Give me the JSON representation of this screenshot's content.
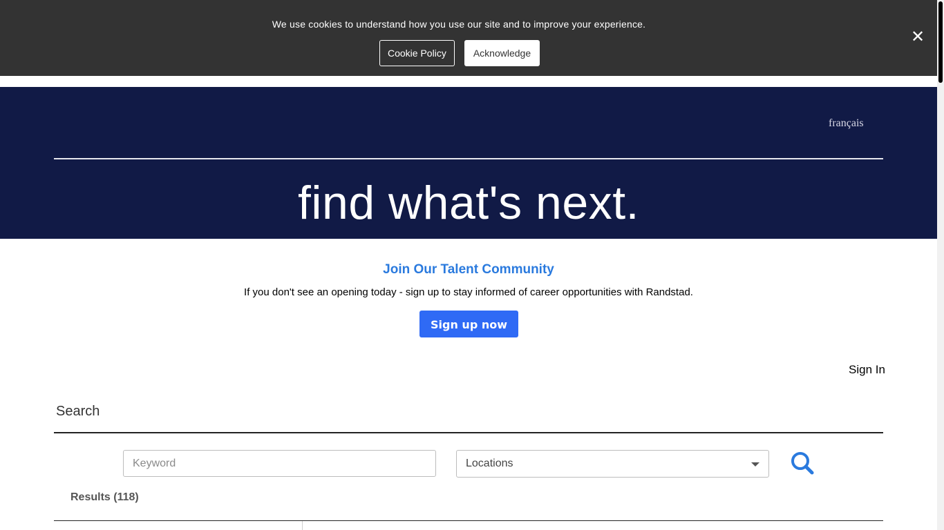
{
  "cookie_banner": {
    "message": "We use cookies to understand how you use our site and to improve your experience.",
    "policy_label": "Cookie Policy",
    "acknowledge_label": "Acknowledge",
    "close_icon": "close-icon",
    "close_glyph": "✕"
  },
  "header": {
    "language_link": "français",
    "hero_title": "find what's next."
  },
  "talent_community": {
    "title": "Join Our Talent Community",
    "text": "If you don't see an opening today - sign up to stay informed of career opportunities with Randstad.",
    "signup_label": "Sign up now"
  },
  "account": {
    "sign_in_label": "Sign In"
  },
  "search": {
    "heading": "Search",
    "keyword_placeholder": "Keyword",
    "keyword_value": "",
    "location_label": "Locations",
    "search_icon": "search-icon"
  },
  "results": {
    "label": "Results (118)"
  },
  "colors": {
    "hero_bg": "#111a46",
    "cookie_bg": "#333333",
    "accent_blue": "#2f6af5",
    "title_blue": "#2a7ade"
  }
}
